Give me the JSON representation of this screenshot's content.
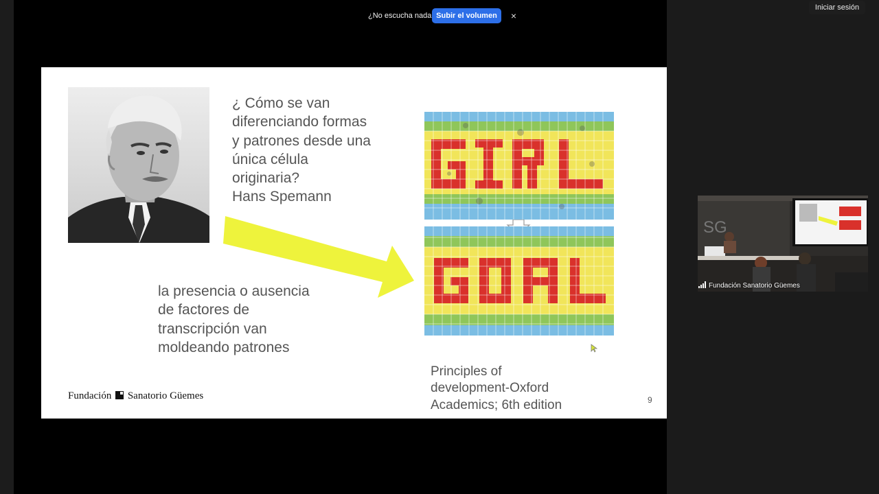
{
  "notification": {
    "text": "¿No escucha nada?",
    "button_label": "Subir el volumen",
    "close_label": "×"
  },
  "header": {
    "login_label": "Iniciar sesión"
  },
  "slide": {
    "question": "¿ Cómo se van\ndiferenciando formas\ny patrones desde una\núnica célula\noriginaria?\nHans Spemann",
    "answer": "la presencia o ausencia\nde factores de\ntranscripción van\nmoldeando patrones",
    "citation": "Principles of\ndevelopment-Oxford\nAcademics; 6th edition",
    "page_number": "9",
    "logo_left": "Fundación",
    "logo_right": "Sanatorio Güemes",
    "mosaic_top_word": "GIRL",
    "mosaic_bottom_word": "GOAL"
  },
  "participant": {
    "name": "Fundación Sanatorio Güemes",
    "room_letters": "SG"
  },
  "colors": {
    "accent_button": "#2d6fe8",
    "arrow_yellow": "#eef33c",
    "mosaic_red": "#d9312b",
    "mosaic_yellow": "#f1e55a",
    "mosaic_green": "#8fc65a",
    "mosaic_blue": "#7bbde3"
  }
}
